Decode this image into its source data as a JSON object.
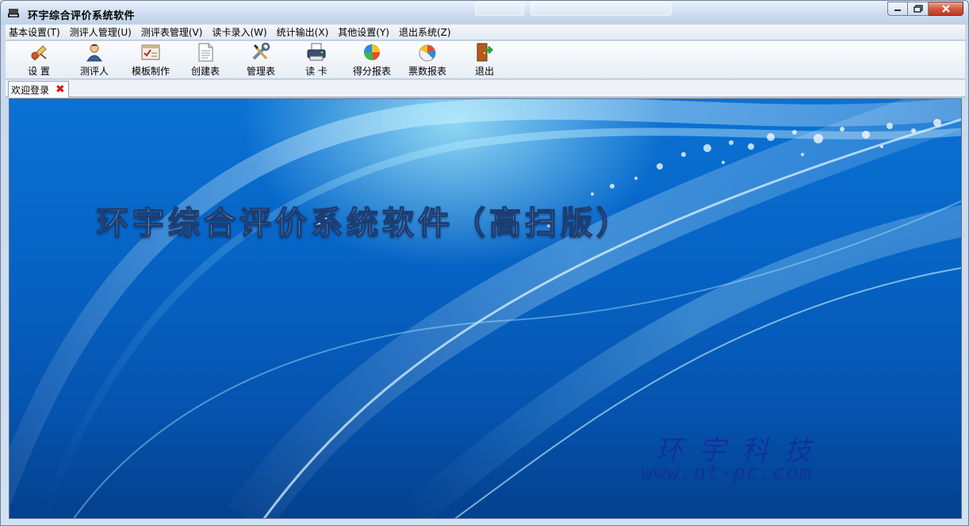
{
  "window": {
    "title": "环宇综合评价系统软件"
  },
  "menu": [
    {
      "label": "基本设置(T)"
    },
    {
      "label": "测评人管理(U)"
    },
    {
      "label": "测评表管理(V)"
    },
    {
      "label": "读卡录入(W)"
    },
    {
      "label": "统计输出(X)"
    },
    {
      "label": "其他设置(Y)"
    },
    {
      "label": "退出系统(Z)"
    }
  ],
  "toolbar": [
    {
      "label": "设  置",
      "icon": "settings-icon"
    },
    {
      "label": "测评人",
      "icon": "person-icon"
    },
    {
      "label": "模板制作",
      "icon": "template-icon"
    },
    {
      "label": "创建表",
      "icon": "document-icon"
    },
    {
      "label": "管理表",
      "icon": "tools-icon"
    },
    {
      "label": "读  卡",
      "icon": "card-reader-icon"
    },
    {
      "label": "得分报表",
      "icon": "score-chart-icon"
    },
    {
      "label": "票数报表",
      "icon": "vote-chart-icon"
    },
    {
      "label": "退出",
      "icon": "exit-door-icon"
    }
  ],
  "tabs": [
    {
      "label": "欢迎登录"
    }
  ],
  "splash": {
    "title": "环宇综合评价系统软件（高扫版）",
    "company": "环宇科技",
    "url": "www.nt-pc.com"
  },
  "colors": {
    "background_blue": "#0663c4",
    "company_text": "#10329c",
    "close_button": "#c1391c"
  }
}
